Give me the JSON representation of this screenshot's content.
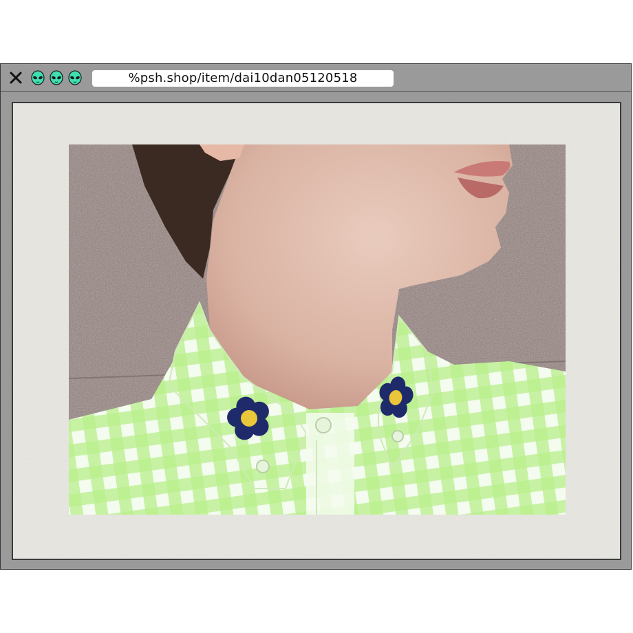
{
  "browser": {
    "url": "%psh.shop/item/dai10dan05120518",
    "close_icon": "close-icon",
    "tab_icons": [
      "alien-icon",
      "alien-icon",
      "alien-icon"
    ],
    "accent_color": "#3fdfb0"
  },
  "content": {
    "image": "photo-of-neck-and-green-gingham-collar-with-navy-flower-embroidery",
    "gingham_color": "#b8ef8a",
    "flower_color": "#1f2a6b",
    "flower_center_color": "#e9c63a"
  }
}
